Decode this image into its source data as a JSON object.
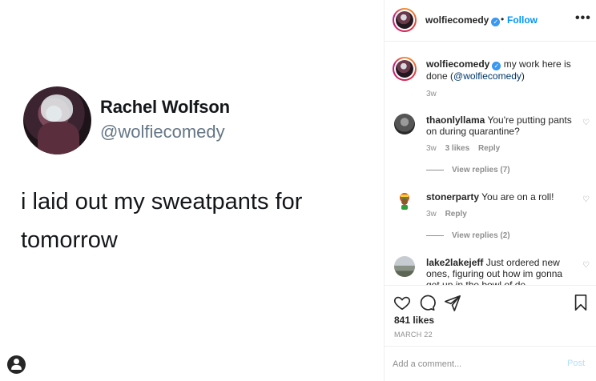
{
  "post": {
    "tweet_name": "Rachel Wolfson",
    "tweet_handle": "@wolfiecomedy",
    "tweet_text": "i laid out my sweatpants for tomorrow"
  },
  "header": {
    "username": "wolfiecomedy",
    "separator": "•",
    "follow_label": "Follow",
    "more_label": "•••"
  },
  "caption": {
    "username": "wolfiecomedy",
    "text_before": "my work here is done (",
    "mention": "@wolfiecomedy",
    "text_after": ")",
    "time": "3w"
  },
  "comments": [
    {
      "username": "thaonlyllama",
      "text": "You're putting pants on during quarantine?",
      "time": "3w",
      "likes": "3 likes",
      "reply_label": "Reply",
      "view_replies": "View replies (7)"
    },
    {
      "username": "stonerparty",
      "text": "You are on a roll!",
      "time": "3w",
      "reply_label": "Reply",
      "view_replies": "View replies (2)"
    },
    {
      "username": "lake2lakejeff",
      "text": "Just ordered new ones, figuring out how im gonna get up in the bowl of de"
    }
  ],
  "actions": {
    "likes": "841 likes",
    "date": "MARCH 22",
    "comment_placeholder": "Add a comment...",
    "post_label": "Post"
  },
  "colors": {
    "accent": "#0095f6",
    "verified": "#3897f0",
    "muted": "#8e8e8e",
    "post_disabled": "#b2dffc"
  },
  "icons": {
    "like": "heart-icon",
    "comment": "comment-icon",
    "share": "share-icon",
    "save": "bookmark-icon",
    "tag": "user-tag-icon",
    "verified": "verified-badge-icon",
    "comment_like": "small-heart-icon"
  }
}
